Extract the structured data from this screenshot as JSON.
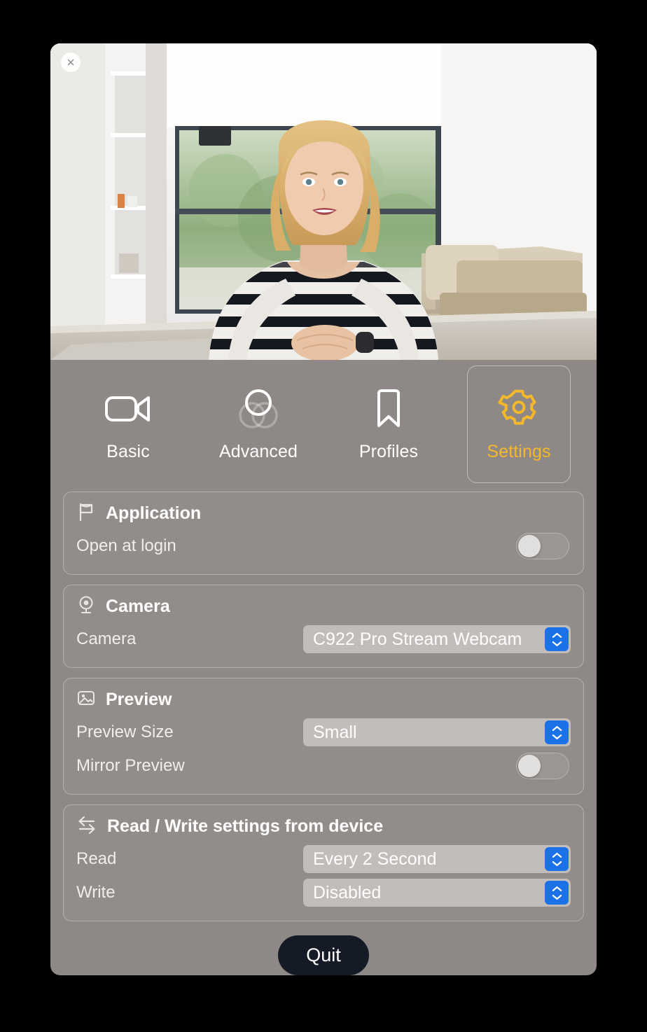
{
  "window": {
    "close_label": "close",
    "accent_color": "#f5b82a",
    "stepper_color": "#1a71e8",
    "panel_color": "#8e8986",
    "quit_button_color": "#141a26"
  },
  "preview": {
    "icon": "webcam-preview",
    "description": "Live camera preview"
  },
  "tabs": [
    {
      "label": "Basic",
      "icon": "video-camera-icon",
      "active": false
    },
    {
      "label": "Advanced",
      "icon": "venn-circles-icon",
      "active": false
    },
    {
      "label": "Profiles",
      "icon": "bookmark-icon",
      "active": false
    },
    {
      "label": "Settings",
      "icon": "gear-icon",
      "active": true
    }
  ],
  "sections": [
    {
      "title": "Application",
      "icon": "flag-icon",
      "rows": [
        {
          "label": "Open at login",
          "control": "toggle",
          "value": "off"
        }
      ]
    },
    {
      "title": "Camera",
      "icon": "webcam-icon",
      "rows": [
        {
          "label": "Camera",
          "control": "select",
          "value": "C922 Pro Stream Webcam"
        }
      ]
    },
    {
      "title": "Preview",
      "icon": "image-icon",
      "rows": [
        {
          "label": "Preview Size",
          "control": "select",
          "value": "Small"
        },
        {
          "label": "Mirror Preview",
          "control": "toggle",
          "value": "off"
        }
      ]
    },
    {
      "title": "Read / Write settings from device",
      "icon": "read-write-arrows-icon",
      "rows": [
        {
          "label": "Read",
          "control": "select",
          "value": "Every 2 Second"
        },
        {
          "label": "Write",
          "control": "select",
          "value": "Disabled"
        }
      ]
    }
  ],
  "footer": {
    "quit_label": "Quit"
  }
}
